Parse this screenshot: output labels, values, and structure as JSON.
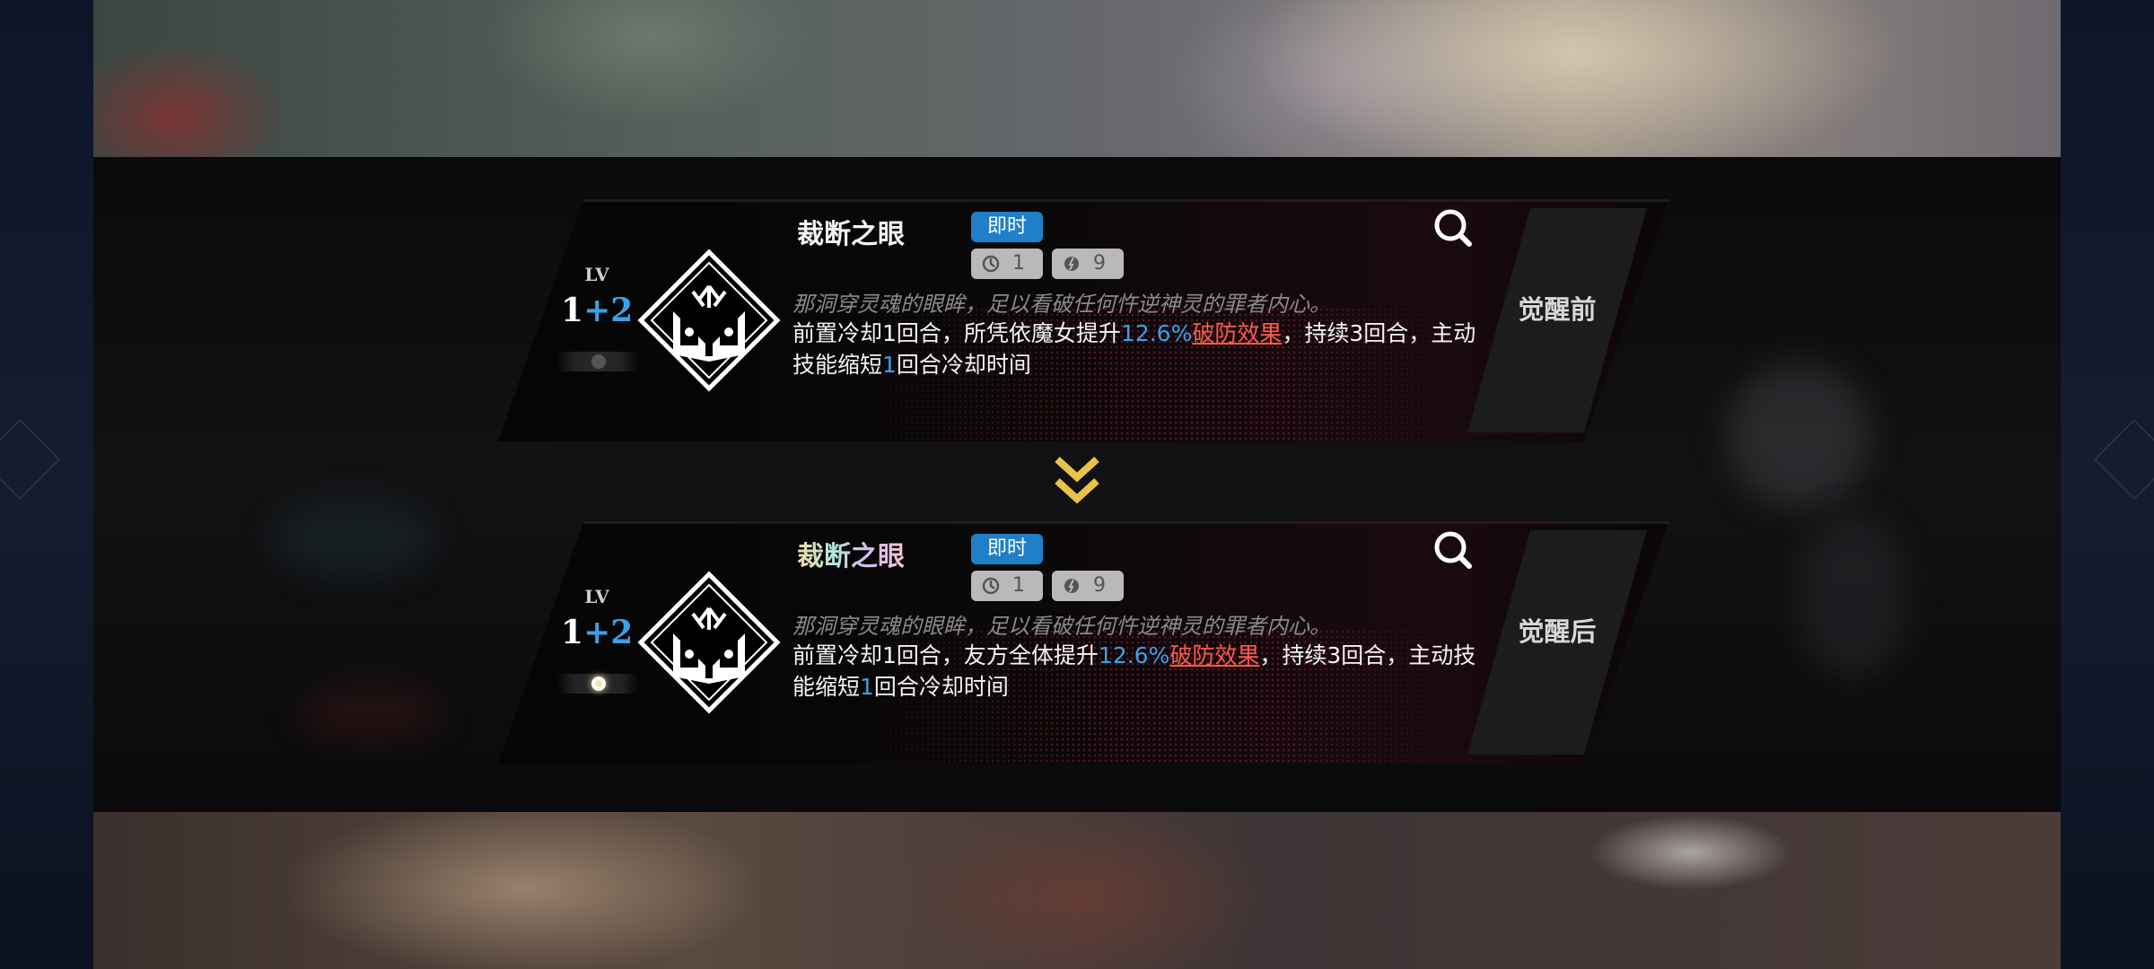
{
  "cards": [
    {
      "lv_label": "LV",
      "lv_base": "1",
      "lv_plus": "+2",
      "awakened": false,
      "skill_name": "裁断之眼",
      "tag": "即时",
      "cooldown": "1",
      "cost": "9",
      "flavor": "那洞穿灵魂的眼眸，足以看破任何忤逆神灵的罪者内心。",
      "desc": {
        "p1": "前置冷却1回合，所凭依魔女提升",
        "value": "12.6%",
        "effect": "破防效果",
        "p2": "，持续3回合，主动技能缩短",
        "reduce": "1",
        "p3": "回合冷却时间"
      },
      "badge": "觉醒前"
    },
    {
      "lv_label": "LV",
      "lv_base": "1",
      "lv_plus": "+2",
      "awakened": true,
      "skill_name": "裁断之眼",
      "tag": "即时",
      "cooldown": "1",
      "cost": "9",
      "flavor": "那洞穿灵魂的眼眸，足以看破任何忤逆神灵的罪者内心。",
      "desc": {
        "p1": "前置冷却1回合，友方全体提升",
        "value": "12.6%",
        "effect": "破防效果",
        "p2": "，持续3回合，主动技能缩短",
        "reduce": "1",
        "p3": "回合冷却时间"
      },
      "badge": "觉醒后"
    }
  ],
  "colors": {
    "tag": "#1f7fc8",
    "value": "#3aa0e8",
    "effect": "#ff5b4b",
    "chevron": "#e8c34a"
  },
  "icons": {
    "skill": "eye-tome-diamond-icon",
    "search": "magnifier-icon",
    "cooldown": "hourglass-icon",
    "cost": "energy-drop-icon",
    "transition": "double-chevron-down-icon"
  }
}
